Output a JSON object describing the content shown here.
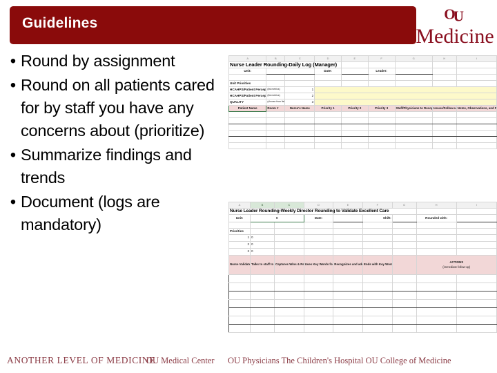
{
  "slide": {
    "title": "Guidelines",
    "title_bar_color": "#8a0b0b",
    "bullets": [
      "Round by assignment",
      "Round on all patients cared for by staff you have any concerns about (prioritize)",
      "Summarize findings and trends",
      "Document (logs are mandatory)"
    ],
    "bullet_marker": "•"
  },
  "logo": {
    "mark": "OU",
    "wordmark": "Medicine",
    "color": "#8a1020"
  },
  "footer": {
    "tagline": "ANOTHER LEVEL OF MEDICINE",
    "org_1": "OU Medical Center",
    "org_2": "OU Physicians   The Children's Hospital   OU College of Medicine"
  },
  "sheet1": {
    "column_letters": [
      "A",
      "B",
      "C",
      "D",
      "E",
      "F",
      "G",
      "H",
      "I"
    ],
    "title": "Nurse Leader Rounding-Daily Log (Manager)",
    "fields": {
      "unit_label": "Unit:",
      "date_label": "Date:",
      "leader_label": "Leader:"
    },
    "priority_section": {
      "unit_priorities_label": "Unit Priorities",
      "rows": [
        {
          "label": "HCAHPS/Patient Perception",
          "note": "(list metrics)",
          "num": "1"
        },
        {
          "label": "HCAHPS/Patient Perception",
          "note": "(list metrics)",
          "num": "2"
        },
        {
          "label": "QUALITY",
          "note": "(choose from list of standard audits/unit selected or monitored quarterly)",
          "num": "3"
        }
      ]
    },
    "headers": [
      "Patient Name",
      "Room #",
      "Nurse's Name",
      "Priority 1",
      "Priority 2",
      "Priority 3",
      "Staff/Physicians to Recognize (who and what)",
      "Issues/Follow-up",
      "Notes, Observations, and Patient Comments"
    ],
    "empty_rows": 6
  },
  "sheet2": {
    "column_letters": [
      "A",
      "B",
      "C",
      "D",
      "E",
      "F",
      "G",
      "H",
      "I"
    ],
    "title": "Nurse Leader Rounding-Weekly Director Rounding to Validate Excellent Care",
    "fields": {
      "unit_label": "Unit:",
      "unit_value": "0",
      "date_label": "Date:",
      "shift_label": "Shift:",
      "rounded_with_label": "Rounded with:"
    },
    "priority_section": {
      "priorities_label": "Priorities",
      "rows": [
        {
          "num": "1",
          "value": "0"
        },
        {
          "num": "2",
          "value": "0"
        },
        {
          "num": "3",
          "value": "0"
        }
      ]
    },
    "headers": [
      "Nurse Validated",
      "Talks to staff to prepare for patients",
      "Captures Wins & Recognition",
      "Uses Key Words for Patient Priorities",
      "Recognizes and adds cases need for service",
      "Ends with Key Words and leaves business need",
      "",
      "ACTIONS"
    ],
    "actions_label": "ACTIONS",
    "actions_sub": "(immediate follow-up)",
    "empty_rows": 7
  }
}
